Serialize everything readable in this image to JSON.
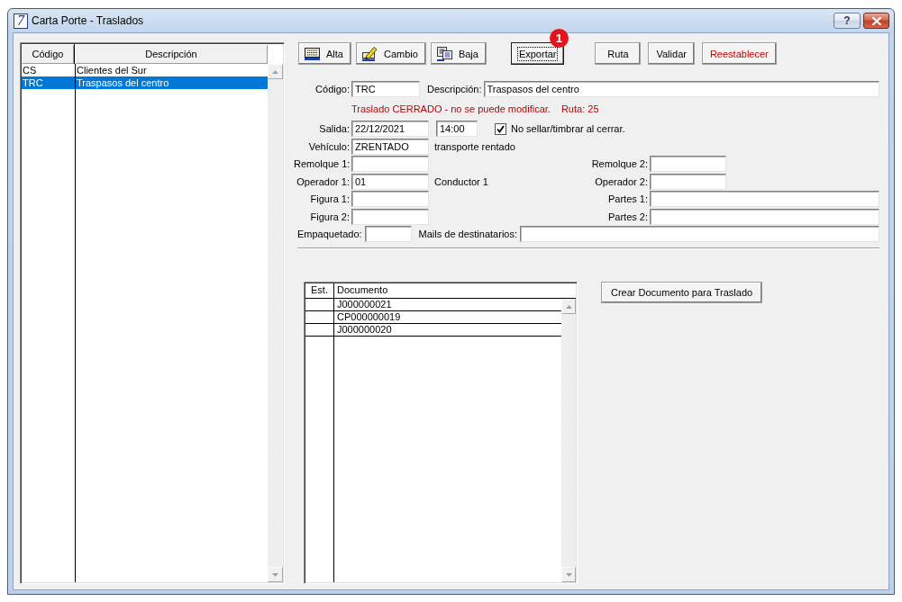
{
  "window": {
    "logo": "7",
    "title": "Carta Porte - Traslados",
    "help": "?"
  },
  "list": {
    "columns": [
      "Código",
      "Descripción"
    ],
    "rows": [
      {
        "code": "CS",
        "description": "Clientes del Sur",
        "selected": false
      },
      {
        "code": "TRC",
        "description": "Traspasos del centro",
        "selected": true
      }
    ]
  },
  "toolbar": [
    {
      "buttons": [
        {
          "label": "Alta",
          "kind": "add",
          "focused": false
        },
        {
          "label": "Cambio",
          "kind": "edit",
          "focused": false
        },
        {
          "label": "Baja",
          "kind": "remove",
          "focused": false
        }
      ]
    },
    {
      "buttons": [
        {
          "label": "Exportar",
          "kind": "text",
          "focused": true,
          "badge": "1"
        }
      ]
    },
    {
      "buttons": [
        {
          "label": "Ruta",
          "kind": "text",
          "focused": false
        },
        {
          "label": "Validar",
          "kind": "text",
          "focused": false
        },
        {
          "label": "Reestablecer",
          "kind": "alert",
          "focused": false
        }
      ]
    }
  ],
  "form": {
    "code": {
      "label": "Código:",
      "value": "TRC"
    },
    "description": {
      "label": "Descripción:",
      "value": "Traspasos del centro"
    },
    "status": {
      "message": "Traslado CERRADO - no se puede modificar.",
      "route": "Ruta: 25"
    },
    "departure": {
      "label": "Salida:",
      "date": "22/12/2021",
      "time": "14:00"
    },
    "no_stamp": {
      "label": "No sellar/timbrar al cerrar.",
      "checked": true
    },
    "vehicle": {
      "label": "Vehículo:",
      "value": "ZRENTADO",
      "note": "transporte rentado"
    },
    "pairs": [
      {
        "left": {
          "label": "Remolque 1:"
        },
        "right": {
          "label": "Remolque 2:"
        }
      },
      {
        "left": {
          "label": "Operador 1:",
          "value": "01",
          "note": "Conductor 1"
        },
        "right": {
          "label": "Operador 2:"
        }
      }
    ],
    "parts": [
      {
        "left": {
          "label": "Figura 1:"
        },
        "right": {
          "label": "Partes 1:"
        }
      },
      {
        "left": {
          "label": "Figura 2:"
        },
        "right": {
          "label": "Partes 2:"
        }
      }
    ],
    "packaging": {
      "label": "Empaquetado:"
    },
    "recipients": {
      "label": "Mails de destinatarios:"
    }
  },
  "documents": {
    "columns": [
      "Est.",
      "Documento"
    ],
    "rows": [
      {
        "document": "J000000021"
      },
      {
        "document": "CP000000019"
      },
      {
        "document": "J000000020"
      }
    ]
  },
  "create_button": {
    "label": "Crear Documento para Traslado"
  }
}
